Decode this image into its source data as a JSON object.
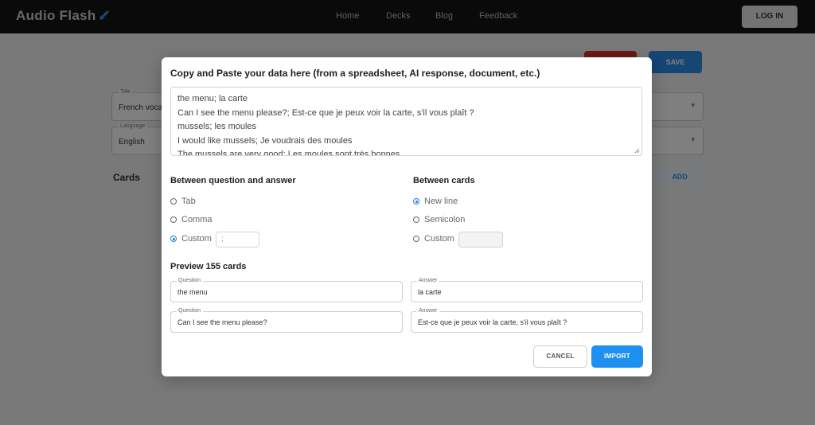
{
  "navbar": {
    "logo": "Audio Flash",
    "links": [
      "Home",
      "Decks",
      "Blog",
      "Feedback"
    ],
    "login_label": "LOG IN"
  },
  "background": {
    "save_label": "SAVE",
    "cards_heading": "Cards",
    "add_label": "ADD",
    "field1": {
      "label": "Title",
      "value": "French vocab"
    },
    "field2": {
      "label": "Language",
      "value": "English"
    }
  },
  "modal": {
    "title": "Copy and Paste your data here (from a spreadsheet, AI response, document, etc.)",
    "paste_lines": [
      "the menu; la carte",
      "Can I see the menu please?; Est-ce que je peux voir la carte, s'il vous plaît ?",
      "mussels; les moules",
      "I would like mussels; Je voudrais des moules",
      "The mussels are very good; Les moules sont très bonnes"
    ],
    "qa_separator": {
      "heading": "Between question and answer",
      "options": [
        "Tab",
        "Comma",
        "Custom"
      ],
      "selected": "Custom",
      "custom_value": ";"
    },
    "card_separator": {
      "heading": "Between cards",
      "options": [
        "New line",
        "Semicolon",
        "Custom"
      ],
      "selected": "New line",
      "custom_value": ""
    },
    "preview": {
      "heading": "Preview 155 cards",
      "question_label": "Question",
      "answer_label": "Answer",
      "rows": [
        {
          "question": "the menu",
          "answer": "la carte"
        },
        {
          "question": "Can I see the menu please?",
          "answer": "Est-ce que je peux voir la carte, s'il vous plaît ?"
        }
      ]
    },
    "cancel_label": "CANCEL",
    "import_label": "IMPORT"
  },
  "colors": {
    "accent": "#1e90ef",
    "radio_selected": "#1e7fe0",
    "navbar": "#141414"
  }
}
